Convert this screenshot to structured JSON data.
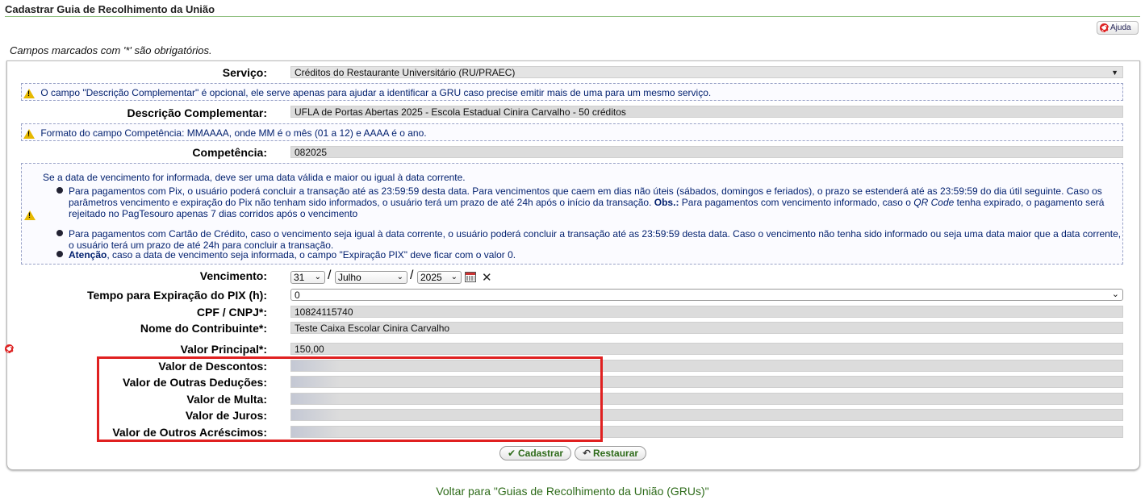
{
  "page": {
    "title": "Cadastrar Guia de Recolhimento da União",
    "help_label": "Ajuda",
    "required_note": "Campos marcados com '*' são obrigatórios."
  },
  "form": {
    "servico": {
      "label": "Serviço:",
      "value": "Créditos do Restaurante Universitário (RU/PRAEC)"
    },
    "notice_descricao": "O campo \"Descrição Complementar\" é opcional, ele serve apenas para ajudar a identificar a GRU caso precise emitir mais de uma para um mesmo serviço.",
    "descricao": {
      "label": "Descrição Complementar:",
      "value": "UFLA de Portas Abertas 2025 - Escola Estadual Cinira Carvalho - 50 créditos"
    },
    "notice_competencia": "Formato do campo Competência: MMAAAA, onde MM é o mês (01 a 12) e AAAA é o ano.",
    "competencia": {
      "label": "Competência:",
      "value": "082025"
    },
    "notice_vencimento": {
      "intro": "Se a data de vencimento for informada, deve ser uma data válida e maior ou igual à data corrente.",
      "b1_a": "Para pagamentos com Pix, o usuário poderá concluir a transação até as 23:59:59 desta data. Para vencimentos que caem em dias não úteis (sábados, domingos e feriados), o prazo se estenderá até as 23:59:59 do dia útil seguinte. Caso os parâmetros vencimento e expiração do Pix não tenham sido informados, o usuário terá um prazo de até 24h após o início da transação. ",
      "b1_obs": "Obs.:",
      "b1_b": " Para pagamentos com vencimento informado, caso o ",
      "b1_qr": "QR Code",
      "b1_c": " tenha expirado, o pagamento será rejeitado no PagTesouro apenas 7 dias corridos após o vencimento",
      "b2": "Para pagamentos com Cartão de Crédito, caso o vencimento seja igual à data corrente, o usuário poderá concluir a transação até as 23:59:59 desta data. Caso o vencimento não tenha sido informado ou seja uma data maior que a data corrente, o usuário terá um prazo de até 24h para concluir a transação.",
      "b3_bold": "Atenção",
      "b3": ", caso a data de vencimento seja informada, o campo \"Expiração PIX\" deve ficar com o valor 0."
    },
    "vencimento": {
      "label": "Vencimento:",
      "day": "31",
      "month": "Julho",
      "year": "2025",
      "sep": "/"
    },
    "expiracao_pix": {
      "label": "Tempo para Expiração do PIX (h):",
      "value": "0"
    },
    "cpf": {
      "label": "CPF / CNPJ*:",
      "value": "10824115740"
    },
    "contribuinte": {
      "label": "Nome do Contribuinte*:",
      "value": "Teste Caixa Escolar Cinira Carvalho"
    },
    "valor_principal": {
      "label": "Valor Principal*:",
      "value": "150,00"
    },
    "valor_descontos": {
      "label": "Valor de Descontos:",
      "value": ""
    },
    "valor_deducoes": {
      "label": "Valor de Outras Deduções:",
      "value": ""
    },
    "valor_multa": {
      "label": "Valor de Multa:",
      "value": ""
    },
    "valor_juros": {
      "label": "Valor de Juros:",
      "value": ""
    },
    "valor_acrescimos": {
      "label": "Valor de Outros Acréscimos:",
      "value": ""
    }
  },
  "buttons": {
    "cadastrar": "Cadastrar",
    "restaurar": "Restaurar"
  },
  "back_link": "Voltar para \"Guias de Recolhimento da União (GRUs)\"",
  "colors": {
    "accent_green": "#2e6b1a",
    "highlight_red": "#e02020",
    "notice_text": "#001f6e"
  }
}
